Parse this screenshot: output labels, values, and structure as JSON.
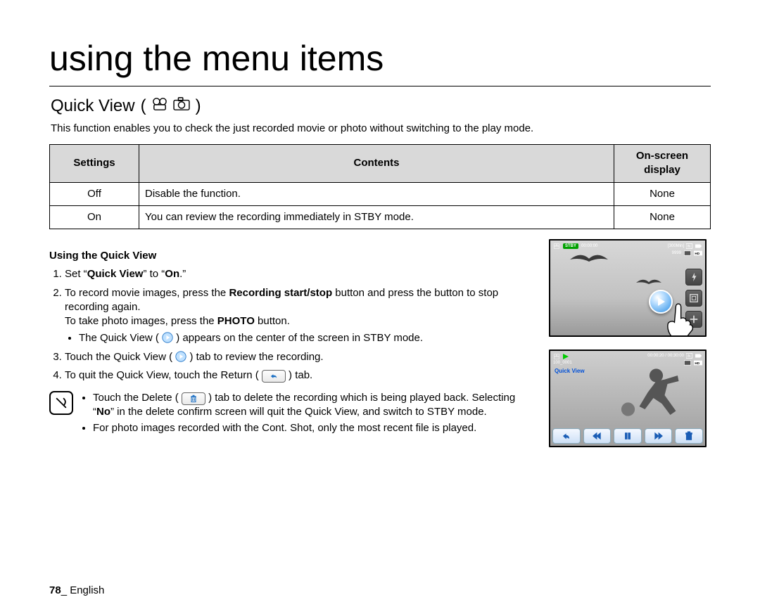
{
  "chapter_title": "using the menu items",
  "section": {
    "title": "Quick View",
    "description": "This function enables you to check the just recorded movie or photo without switching to the play mode."
  },
  "table": {
    "headers": {
      "settings": "Settings",
      "contents": "Contents",
      "osd": "On-screen\ndisplay"
    },
    "rows": [
      {
        "setting": "Off",
        "content": "Disable the function.",
        "osd": "None"
      },
      {
        "setting": "On",
        "content": "You can review the recording immediately in STBY mode.",
        "osd": "None"
      }
    ]
  },
  "using": {
    "heading": "Using the Quick View",
    "step1_pre": "Set “",
    "step1_bold1": "Quick View",
    "step1_mid": "” to “",
    "step1_bold2": "On",
    "step1_post": ".”",
    "step2_a": "To record movie images, press the ",
    "step2_bold": "Recording start/stop",
    "step2_b": " button and press the button to stop recording again.",
    "step2_line2a": "To take photo images, press the ",
    "step2_line2bold": "PHOTO",
    "step2_line2b": " button.",
    "step2_bullet": "The Quick View ( ",
    "step2_bullet_tail": " ) appears on the center of the screen in STBY mode.",
    "step3_a": "Touch the Quick View ( ",
    "step3_b": " ) tab to review the recording.",
    "step4_a": "To quit the Quick View, touch the Return ( ",
    "step4_b": " ) tab."
  },
  "notes": {
    "n1_a": "Touch the Delete ( ",
    "n1_b": " ) tab to delete the recording which is being played back. Selecting “",
    "n1_bold": "No",
    "n1_c": "” in the delete confirm screen will quit the Quick View, and switch to STBY mode.",
    "n2": "For photo images recorded with the Cont. Shot, only the most recent file is played."
  },
  "screenshots": {
    "s1": {
      "stby": "STBY",
      "time": "00:00:00",
      "remain": "[300Min]",
      "count": "9999"
    },
    "s2": {
      "time": "00:00:20 / 00:30:00",
      "file": "100_0001",
      "label": "Quick View"
    }
  },
  "footer": {
    "page": "78",
    "sep": "_ ",
    "lang": "English"
  }
}
